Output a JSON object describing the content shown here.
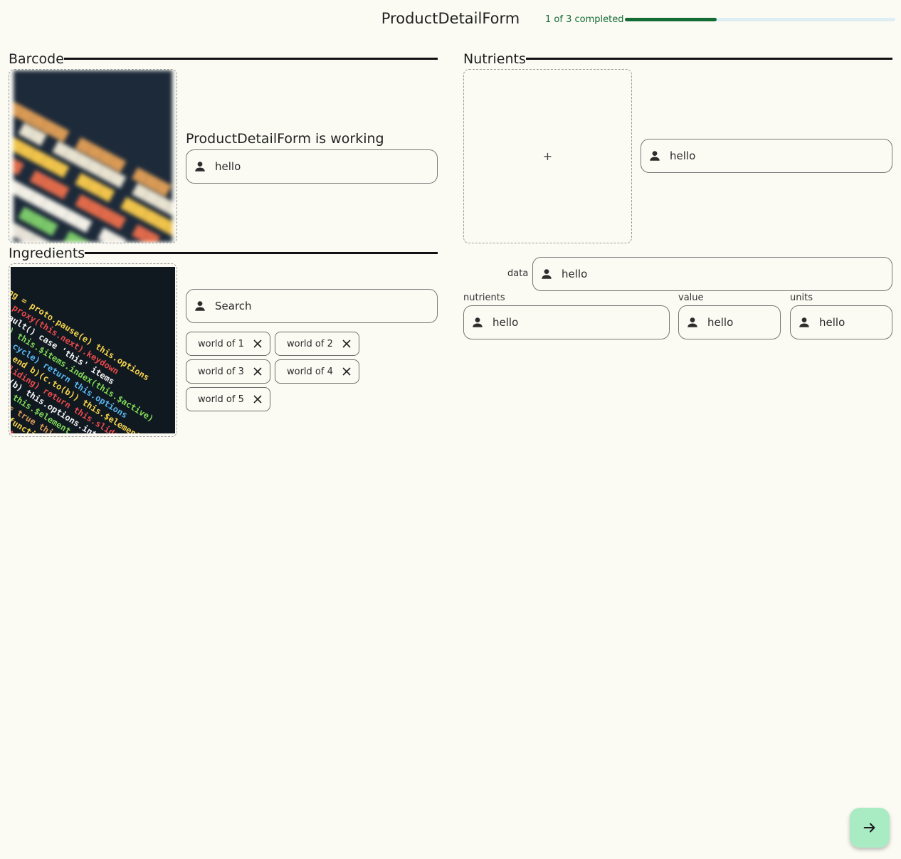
{
  "header": {
    "title": "ProductDetailForm",
    "progress_label": "1 of 3 completed",
    "progress_fraction": 0.34
  },
  "barcode": {
    "legend": "Barcode",
    "status_text": "ProductDetailForm is working",
    "input_value": "hello"
  },
  "ingredients": {
    "legend": "Ingredients",
    "search_placeholder": "Search",
    "chips": [
      "world of 1",
      "world of 2",
      "world of 3",
      "world of 4",
      "world of 5"
    ]
  },
  "nutrients": {
    "legend": "Nutrients",
    "upload_symbol": "+",
    "top_input_value": "hello",
    "data_label": "data",
    "data_value": "hello",
    "nutrients_label": "nutrients",
    "nutrients_value": "hello",
    "value_label": "value",
    "value_value": "hello",
    "units_label": "units",
    "units_value": "hello"
  },
  "icons": {
    "field": "person-icon",
    "chip_remove": "close-icon",
    "next": "arrow-right-icon"
  },
  "colors": {
    "background": "#fbfbf4",
    "accent": "#126c34",
    "fab": "#a9ecc4"
  }
}
